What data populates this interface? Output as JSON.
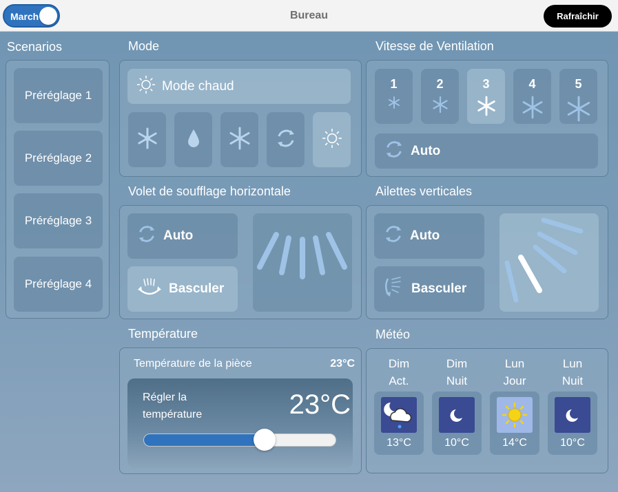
{
  "topbar": {
    "power_label": "March",
    "title": "Bureau",
    "refresh_label": "Rafraîchir"
  },
  "scenarios": {
    "title": "Scenarios",
    "items": [
      {
        "label": "Préréglage 1"
      },
      {
        "label": "Préréglage 2"
      },
      {
        "label": "Préréglage 3"
      },
      {
        "label": "Préréglage 4"
      }
    ]
  },
  "mode": {
    "title": "Mode",
    "current_label": "Mode chaud",
    "options": [
      {
        "icon": "snowflake-icon"
      },
      {
        "icon": "droplet-icon"
      },
      {
        "icon": "fan-icon"
      },
      {
        "icon": "auto-cycle-icon"
      },
      {
        "icon": "sun-heat-icon",
        "active": true
      }
    ]
  },
  "ventilation": {
    "title": "Vitesse de Ventilation",
    "speeds": [
      {
        "label": "1"
      },
      {
        "label": "2"
      },
      {
        "label": "3",
        "active": true
      },
      {
        "label": "4"
      },
      {
        "label": "5"
      }
    ],
    "auto_label": "Auto"
  },
  "horizontal_flap": {
    "title": "Volet de soufflage horizontale",
    "auto_label": "Auto",
    "swing_label": "Basculer",
    "selected": "Basculer"
  },
  "vertical_vanes": {
    "title": "Ailettes verticales",
    "auto_label": "Auto",
    "swing_label": "Basculer"
  },
  "temperature": {
    "title": "Température",
    "room_label": "Température de la pièce",
    "room_value": "23°C",
    "set_label_1": "Régler la",
    "set_label_2": "température",
    "set_value": "23°C",
    "slider_fraction": 0.63
  },
  "weather": {
    "title": "Météo",
    "days": [
      {
        "day": "Dim",
        "period": "Act.",
        "icon": "night-cloud-rain-icon",
        "temp": "13°C"
      },
      {
        "day": "Dim",
        "period": "Nuit",
        "icon": "moon-icon",
        "temp": "10°C"
      },
      {
        "day": "Lun",
        "period": "Jour",
        "icon": "sun-icon",
        "temp": "14°C"
      },
      {
        "day": "Lun",
        "period": "Nuit",
        "icon": "moon-icon",
        "temp": "10°C"
      }
    ]
  },
  "colors": {
    "accent": "#2f73be",
    "panel": "#8aa8c0",
    "night_icon_bg": "#3a4a93",
    "sun_icon_bg": "#9fb8e8"
  }
}
